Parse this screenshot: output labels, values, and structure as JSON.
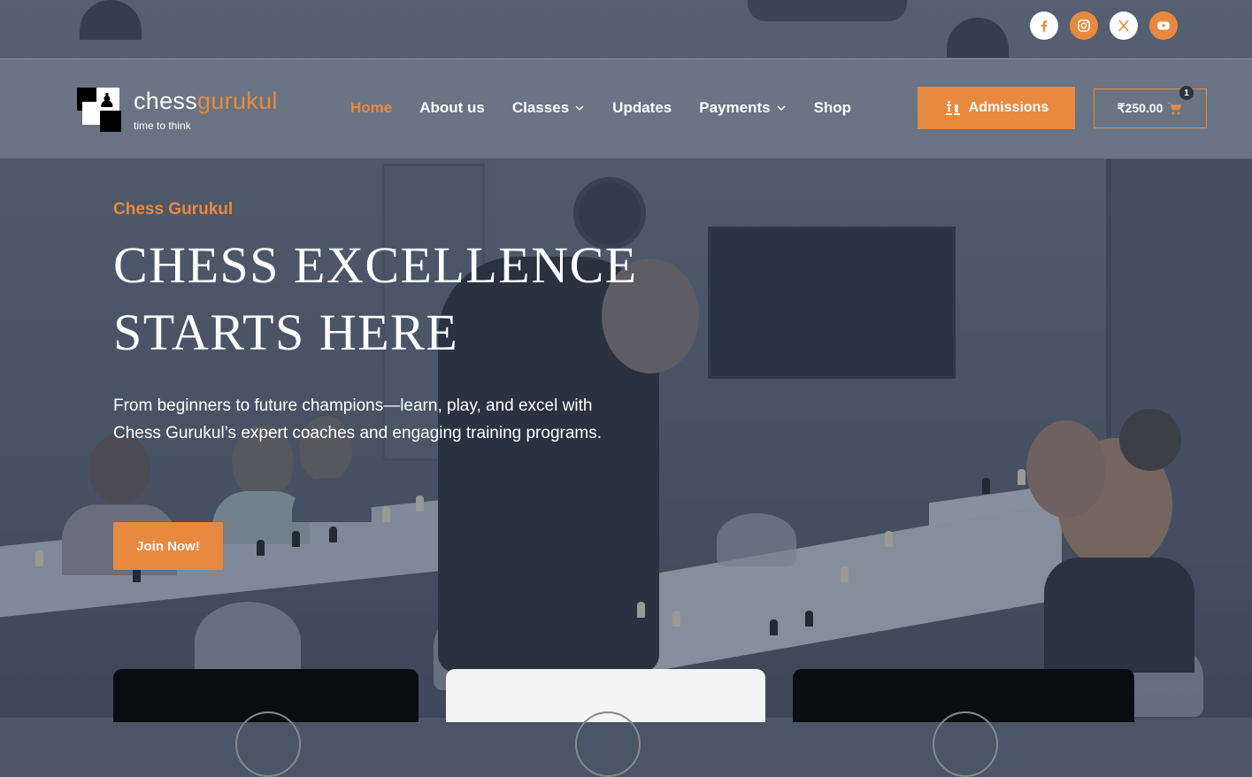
{
  "social": [
    {
      "name": "facebook",
      "icon": "facebook-icon",
      "color": "#e8893f",
      "bg": "#ffffff"
    },
    {
      "name": "instagram",
      "icon": "instagram-icon",
      "color": "#ffffff",
      "bg": "#e8893f"
    },
    {
      "name": "x",
      "icon": "x-icon",
      "color": "#e8893f",
      "bg": "#ffffff"
    },
    {
      "name": "youtube",
      "icon": "youtube-icon",
      "color": "#ffffff",
      "bg": "#e8893f"
    }
  ],
  "logo": {
    "name_part1": "chess",
    "name_part2": "gurukul",
    "tagline": "time to think"
  },
  "nav": {
    "items": [
      {
        "label": "Home",
        "active": true,
        "dropdown": false
      },
      {
        "label": "About us",
        "active": false,
        "dropdown": false
      },
      {
        "label": "Classes",
        "active": false,
        "dropdown": true
      },
      {
        "label": "Updates",
        "active": false,
        "dropdown": false
      },
      {
        "label": "Payments",
        "active": false,
        "dropdown": true
      },
      {
        "label": "Shop",
        "active": false,
        "dropdown": false
      }
    ]
  },
  "header": {
    "admissions_label": "Admissions",
    "cart_total": "₹250.00",
    "cart_count": "1"
  },
  "hero": {
    "eyebrow": "Chess Gurukul",
    "title_line1": "CHESS EXCELLENCE",
    "title_line2": "STARTS HERE",
    "description": "From beginners to future champions—learn, play, and excel with Chess Gurukul’s expert coaches and engaging training programs.",
    "cta_label": "Join Now!"
  },
  "theme": {
    "accent": "#e8893f",
    "text": "#ffffff"
  }
}
